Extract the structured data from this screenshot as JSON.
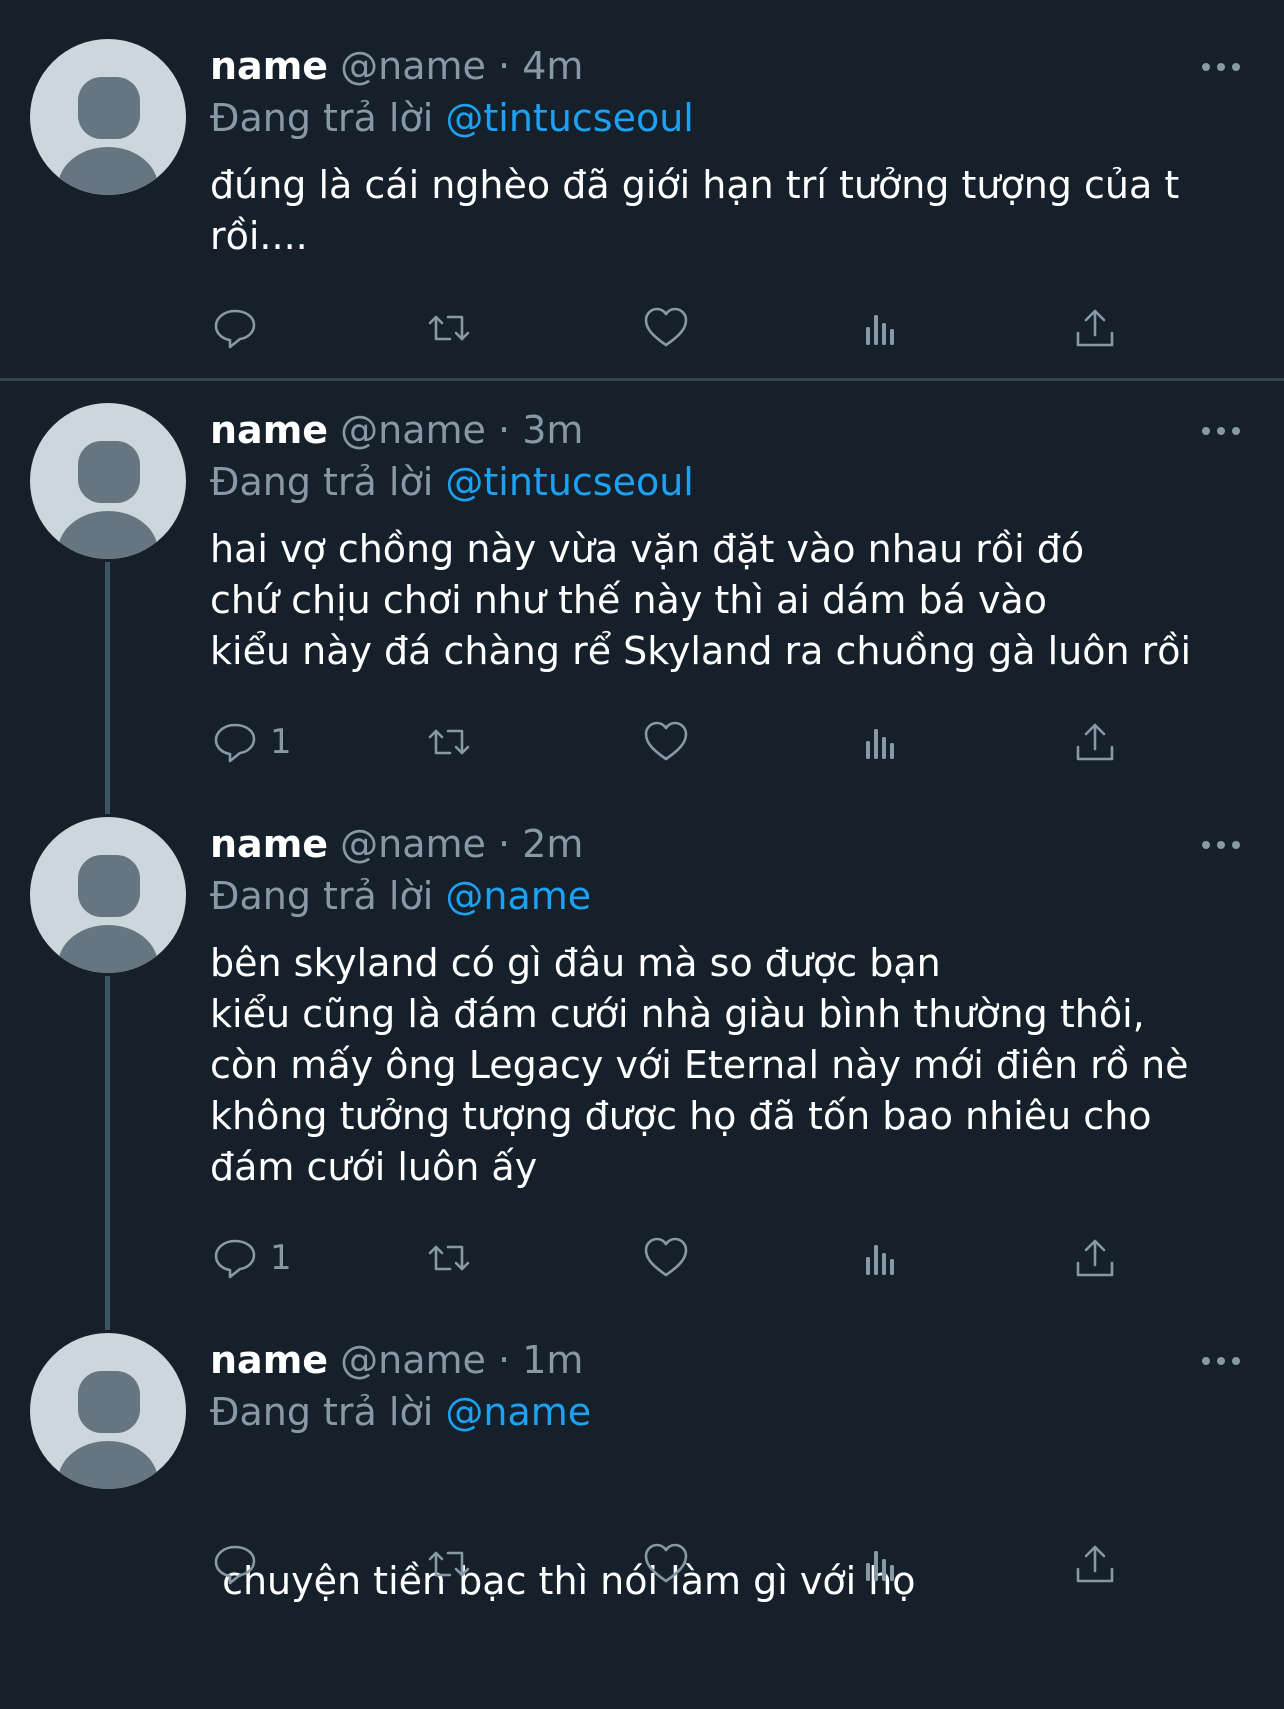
{
  "tweets": [
    {
      "name": "name",
      "handle": "@name",
      "time": "· 4m",
      "reply_prefix": "Đang trả lời",
      "reply_to": "@tintucseoul",
      "lines": [
        "đúng là cái nghèo đã giới hạn trí tưởng tượng của t",
        "rồi...."
      ],
      "reply_count": ""
    },
    {
      "name": "name",
      "handle": "@name",
      "time": "· 3m",
      "reply_prefix": "Đang trả lời",
      "reply_to": "@tintucseoul",
      "lines": [
        "hai vợ chồng này vừa vặn đặt vào nhau rồi đó",
        "chứ chịu chơi như thế này thì ai dám bá vào",
        "kiểu này đá chàng rể Skyland ra chuồng gà luôn rồi"
      ],
      "reply_count": "1"
    },
    {
      "name": "name",
      "handle": "@name",
      "time": "· 2m",
      "reply_prefix": "Đang trả lời",
      "reply_to": "@name",
      "lines": [
        "bên skyland có gì đâu mà so được bạn",
        "kiểu cũng là đám cưới nhà giàu bình thường thôi,",
        "còn mấy ông Legacy với Eternal này mới điên rồ nè",
        "không tưởng tượng được họ đã tốn bao nhiêu cho",
        "đám cưới luôn ấy"
      ],
      "reply_count": "1"
    },
    {
      "name": "name",
      "handle": "@name",
      "time": "· 1m",
      "reply_prefix": "Đang trả lời",
      "reply_to": "@name",
      "lines": [
        " chuyện tiền bạc thì nói làm gì với họ"
      ],
      "reply_count": ""
    }
  ],
  "icons": {
    "reply": "reply-icon",
    "retweet": "retweet-icon",
    "like": "heart-icon",
    "analytics": "analytics-icon",
    "share": "share-icon",
    "more": "more-icon"
  },
  "colors": {
    "background": "#15202b",
    "secondary_text": "#8899a6",
    "mention": "#1da1f2",
    "avatar_bg": "#ccd6dd",
    "avatar_fg": "#66757f"
  }
}
